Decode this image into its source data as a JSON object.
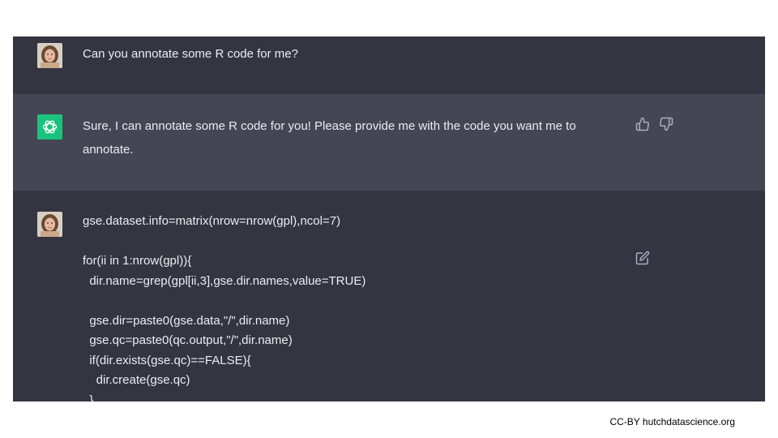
{
  "conversation": {
    "user_prompt": "Can you annotate some R code for me?",
    "assistant_reply": "Sure, I can annotate some R code for you! Please provide me with the code you want me to annotate.",
    "user_code": "gse.dataset.info=matrix(nrow=nrow(gpl),ncol=7)\n\nfor(ii in 1:nrow(gpl)){\n  dir.name=grep(gpl[ii,3],gse.dir.names,value=TRUE)\n\n  gse.dir=paste0(gse.data,\"/\",dir.name)\n  gse.qc=paste0(qc.output,\"/\",dir.name)\n  if(dir.exists(gse.qc)==FALSE){\n    dir.create(gse.qc)\n  }"
  },
  "icons": {
    "user_avatar": "user-avatar",
    "assistant_avatar": "openai-logo-icon",
    "like": "thumbs-up-icon",
    "dislike": "thumbs-down-icon",
    "edit": "edit-icon"
  },
  "colors": {
    "user_row_bg": "#343541",
    "assistant_row_bg": "#444654",
    "assistant_avatar_bg": "#19c37d",
    "text": "#ececf1",
    "icon": "#acacbe"
  },
  "footer": {
    "credit": "CC-BY hutchdatascience.org"
  }
}
